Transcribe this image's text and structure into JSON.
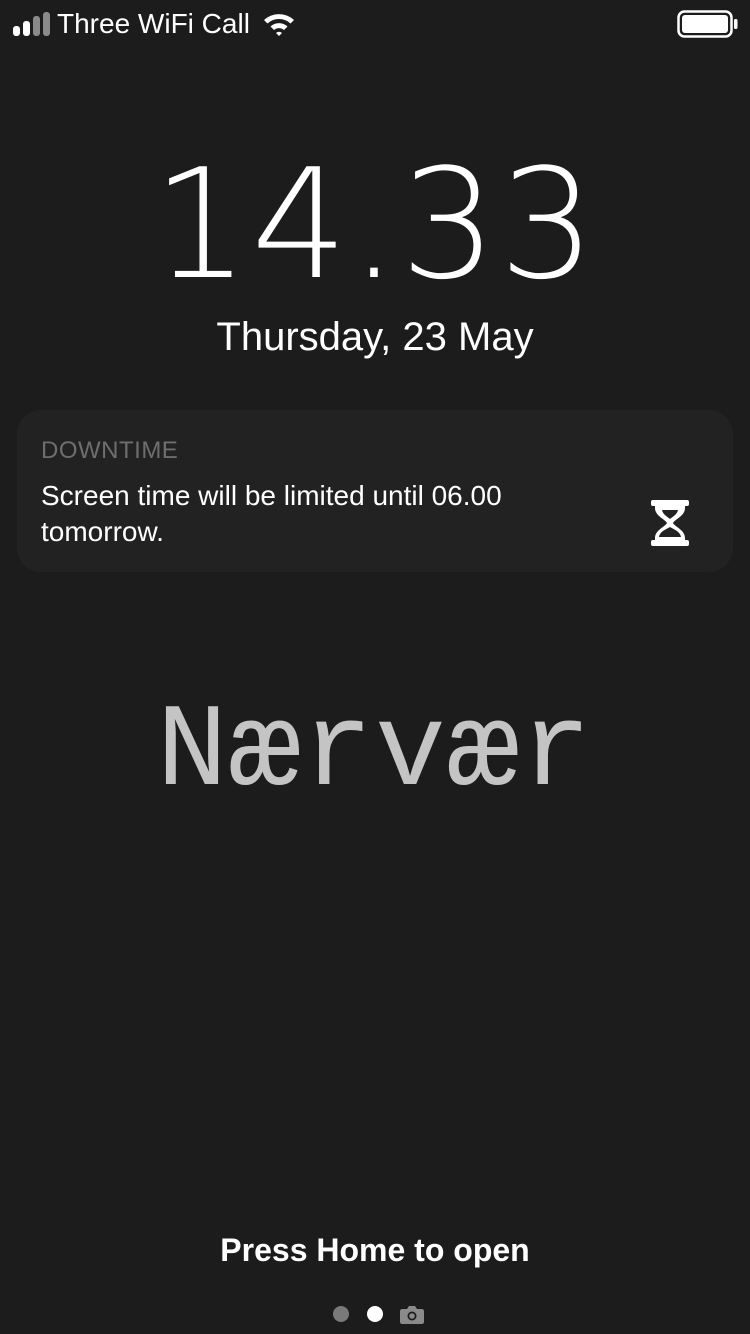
{
  "status_bar": {
    "carrier": "Three WiFi Call",
    "signal_bars_filled": 2,
    "signal_bars_total": 4,
    "battery_level": 1.0,
    "icons": [
      "signal-icon",
      "wifi-icon",
      "battery-icon"
    ]
  },
  "lock_screen": {
    "time": "14.33",
    "date": "Thursday, 23 May"
  },
  "notification": {
    "app": "DOWNTIME",
    "message": "Screen time will be limited until 06.00 tomorrow.",
    "icon": "hourglass-icon"
  },
  "wallpaper_text": "Nærvær",
  "footer": {
    "prompt": "Press Home to open",
    "page_count": 2,
    "current_page": 2,
    "camera_icon": "camera-icon"
  },
  "colors": {
    "background": "#1c1c1c",
    "notification_bg": "#222222",
    "notification_title": "#6e6e6e",
    "wallpaper_text": "#c4c4c4",
    "dot_inactive": "#7a7a7a"
  }
}
